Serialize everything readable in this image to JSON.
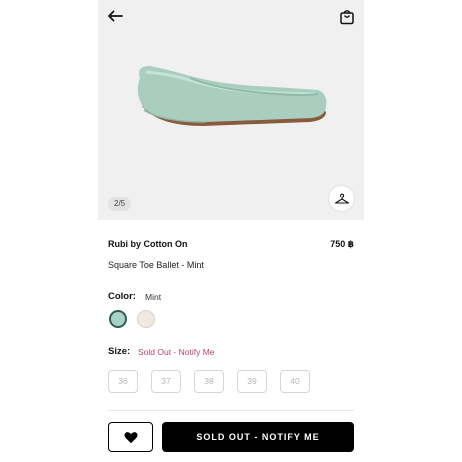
{
  "gallery": {
    "counter": "2/5"
  },
  "product": {
    "brand": "Rubi by Cotton On",
    "price": "750 ฿",
    "name": "Square Toe Ballet - Mint"
  },
  "color": {
    "label": "Color:",
    "selected": "Mint",
    "swatches": [
      {
        "name": "Mint",
        "hex": "#a8d3c4"
      },
      {
        "name": "Ivory",
        "hex": "#f1e9e0"
      }
    ]
  },
  "size": {
    "label": "Size:",
    "status": "Sold Out - Notify Me",
    "options": [
      "36",
      "37",
      "38",
      "39",
      "40"
    ]
  },
  "actions": {
    "notify_label": "SOLD OUT - NOTIFY ME"
  },
  "icons": [
    "back-arrow-icon",
    "shopping-bag-icon",
    "hanger-icon",
    "heart-icon"
  ],
  "colors": {
    "accent": "#b3476f",
    "button": "#000000",
    "hero_bg": "#f0f0f0"
  }
}
